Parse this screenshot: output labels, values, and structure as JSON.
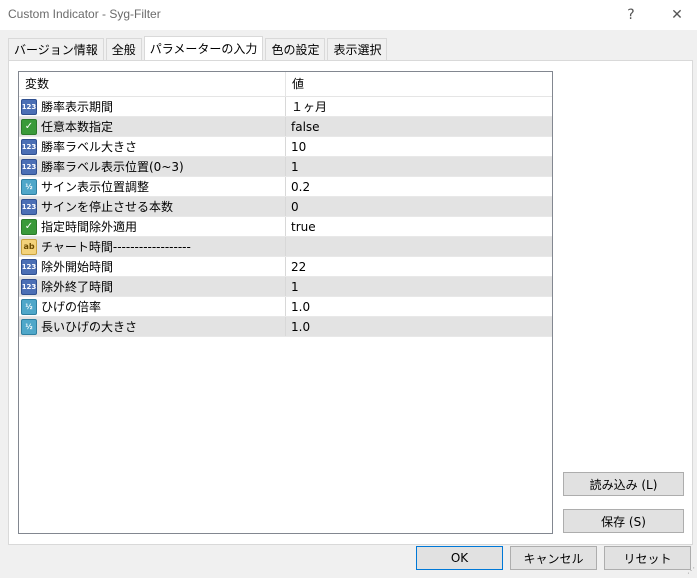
{
  "window": {
    "title": "Custom Indicator - Syg-Filter",
    "help_label": "?",
    "close_label": "✕"
  },
  "tabs": [
    {
      "label": "バージョン情報"
    },
    {
      "label": "全般"
    },
    {
      "label": "パラメーターの入力",
      "active": true
    },
    {
      "label": "色の設定"
    },
    {
      "label": "表示選択"
    }
  ],
  "grid": {
    "col_variable": "変数",
    "col_value": "値",
    "rows": [
      {
        "type": "int",
        "icon": "123",
        "name": "勝率表示期間",
        "value": "１ヶ月"
      },
      {
        "type": "bool",
        "icon": "✓",
        "name": "任意本数指定",
        "value": "false"
      },
      {
        "type": "int",
        "icon": "123",
        "name": "勝率ラベル大きさ",
        "value": "10"
      },
      {
        "type": "int",
        "icon": "123",
        "name": "勝率ラベル表示位置(0~3)",
        "value": "1"
      },
      {
        "type": "double",
        "icon": "½",
        "name": "サイン表示位置調整",
        "value": "0.2"
      },
      {
        "type": "int",
        "icon": "123",
        "name": "サインを停止させる本数",
        "value": "0"
      },
      {
        "type": "bool",
        "icon": "✓",
        "name": "指定時間除外適用",
        "value": "true"
      },
      {
        "type": "string",
        "icon": "ab",
        "name": "チャート時間------------------",
        "value": ""
      },
      {
        "type": "int",
        "icon": "123",
        "name": "除外開始時間",
        "value": "22"
      },
      {
        "type": "int",
        "icon": "123",
        "name": "除外終了時間",
        "value": "1"
      },
      {
        "type": "double",
        "icon": "½",
        "name": "ひげの倍率",
        "value": "1.0"
      },
      {
        "type": "double",
        "icon": "½",
        "name": "長いひげの大きさ",
        "value": "1.0"
      }
    ]
  },
  "buttons": {
    "load": "読み込み (L)",
    "save": "保存 (S)",
    "ok": "OK",
    "cancel": "キャンセル",
    "reset": "リセット"
  }
}
